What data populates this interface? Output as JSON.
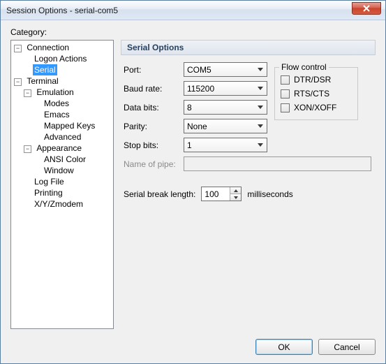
{
  "window": {
    "title": "Session Options - serial-com5"
  },
  "category_label": "Category:",
  "tree": {
    "connection": "Connection",
    "logon_actions": "Logon Actions",
    "serial": "Serial",
    "terminal": "Terminal",
    "emulation": "Emulation",
    "modes": "Modes",
    "emacs": "Emacs",
    "mapped_keys": "Mapped Keys",
    "advanced": "Advanced",
    "appearance": "Appearance",
    "ansi_color": "ANSI Color",
    "window_item": "Window",
    "log_file": "Log File",
    "printing": "Printing",
    "xyzmodem": "X/Y/Zmodem"
  },
  "panel": {
    "header": "Serial Options",
    "port_label": "Port:",
    "port_value": "COM5",
    "baud_label": "Baud rate:",
    "baud_value": "115200",
    "databits_label": "Data bits:",
    "databits_value": "8",
    "parity_label": "Parity:",
    "parity_value": "None",
    "stopbits_label": "Stop bits:",
    "stopbits_value": "1",
    "pipe_label": "Name of pipe:",
    "pipe_value": "",
    "break_label": "Serial break length:",
    "break_value": "100",
    "break_unit": "milliseconds"
  },
  "flow": {
    "legend": "Flow control",
    "dtr": "DTR/DSR",
    "rts": "RTS/CTS",
    "xon": "XON/XOFF"
  },
  "buttons": {
    "ok": "OK",
    "cancel": "Cancel"
  }
}
